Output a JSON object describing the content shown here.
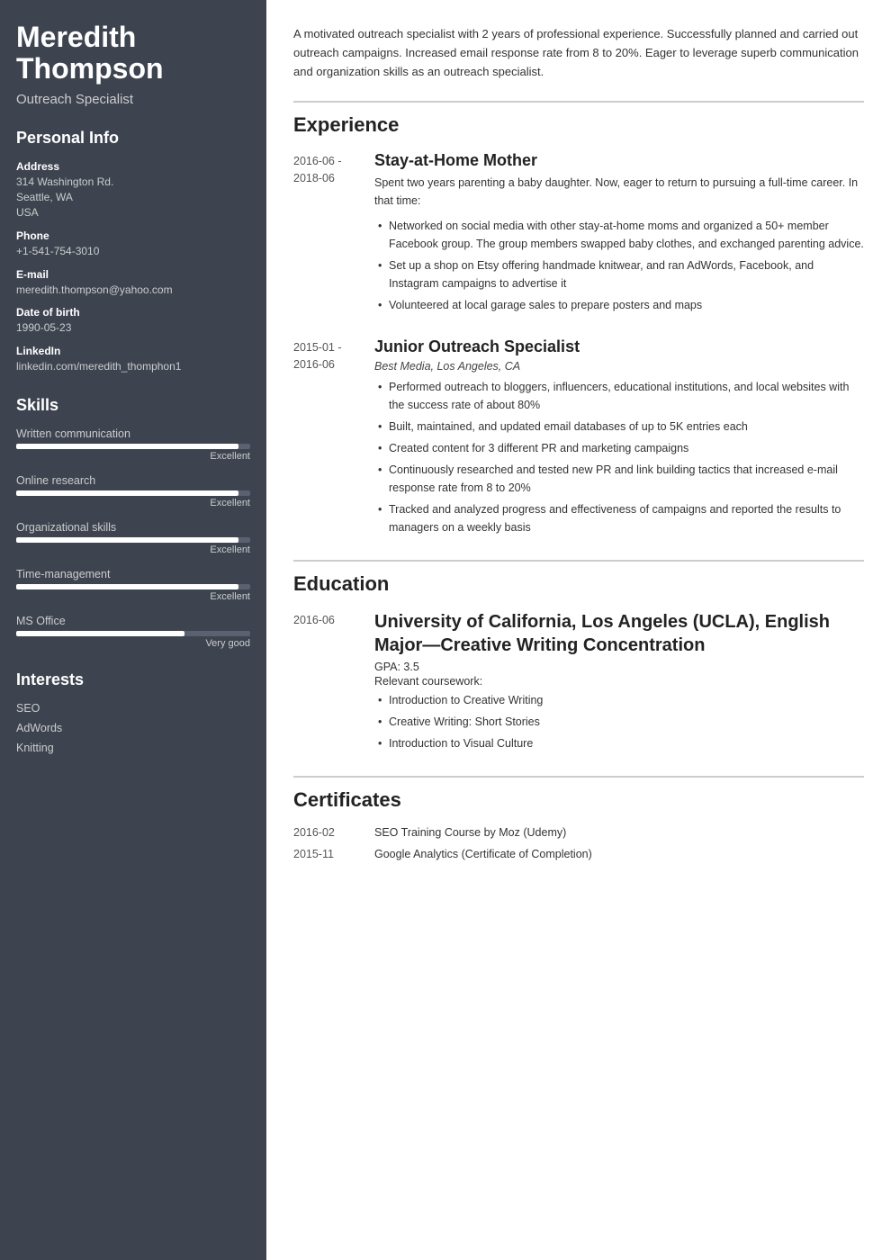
{
  "sidebar": {
    "name": "Meredith Thompson",
    "title": "Outreach Specialist",
    "personal_info_section": "Personal Info",
    "address_label": "Address",
    "address_line1": "314 Washington Rd.",
    "address_line2": "Seattle, WA",
    "address_line3": "USA",
    "phone_label": "Phone",
    "phone_value": "+1-541-754-3010",
    "email_label": "E-mail",
    "email_value": "meredith.thompson@yahoo.com",
    "dob_label": "Date of birth",
    "dob_value": "1990-05-23",
    "linkedin_label": "LinkedIn",
    "linkedin_value": "linkedin.com/meredith_thomphon1",
    "skills_section": "Skills",
    "skills": [
      {
        "name": "Written communication",
        "fill": 95,
        "level": "Excellent"
      },
      {
        "name": "Online research",
        "fill": 95,
        "level": "Excellent"
      },
      {
        "name": "Organizational skills",
        "fill": 95,
        "level": "Excellent"
      },
      {
        "name": "Time-management",
        "fill": 95,
        "level": "Excellent"
      },
      {
        "name": "MS Office",
        "fill": 72,
        "level": "Very good"
      }
    ],
    "interests_section": "Interests",
    "interests": [
      "SEO",
      "AdWords",
      "Knitting"
    ]
  },
  "main": {
    "summary": "A motivated outreach specialist with 2 years of professional experience. Successfully planned and carried out outreach campaigns. Increased email response rate from 8 to 20%. Eager to leverage superb communication and organization skills as an outreach specialist.",
    "experience_section": "Experience",
    "experience": [
      {
        "date": "2016-06 -\n2018-06",
        "job_title": "Stay-at-Home Mother",
        "company": "",
        "description": "Spent two years parenting a baby daughter. Now, eager to return to pursuing a full-time career. In that time:",
        "bullets": [
          "Networked on social media with other stay-at-home moms and organized a 50+ member Facebook group. The group members swapped baby clothes, and exchanged parenting advice.",
          "Set up a shop on Etsy offering handmade knitwear, and ran AdWords, Facebook, and Instagram campaigns to advertise it",
          "Volunteered at local garage sales to prepare posters and maps"
        ]
      },
      {
        "date": "2015-01 -\n2016-06",
        "job_title": "Junior Outreach Specialist",
        "company": "Best Media, Los Angeles, CA",
        "description": "",
        "bullets": [
          "Performed outreach to bloggers, influencers, educational institutions, and local websites with the success rate of about 80%",
          "Built, maintained, and updated email databases of up to 5K entries each",
          "Created content for 3 different PR and marketing campaigns",
          "Continuously researched and tested new PR and link building tactics that increased e-mail response rate from 8 to 20%",
          "Tracked and analyzed progress and effectiveness of campaigns and reported the results to managers on a weekly basis"
        ]
      }
    ],
    "education_section": "Education",
    "education": [
      {
        "date": "2016-06",
        "degree": "University of California, Los Angeles (UCLA), English Major—Creative Writing Concentration",
        "gpa": "GPA: 3.5",
        "coursework_label": "Relevant coursework:",
        "coursework": [
          "Introduction to Creative Writing",
          "Creative Writing: Short Stories",
          "Introduction to Visual Culture"
        ]
      }
    ],
    "certificates_section": "Certificates",
    "certificates": [
      {
        "date": "2016-02",
        "name": "SEO Training Course by Moz (Udemy)"
      },
      {
        "date": "2015-11",
        "name": "Google Analytics (Certificate of Completion)"
      }
    ]
  }
}
